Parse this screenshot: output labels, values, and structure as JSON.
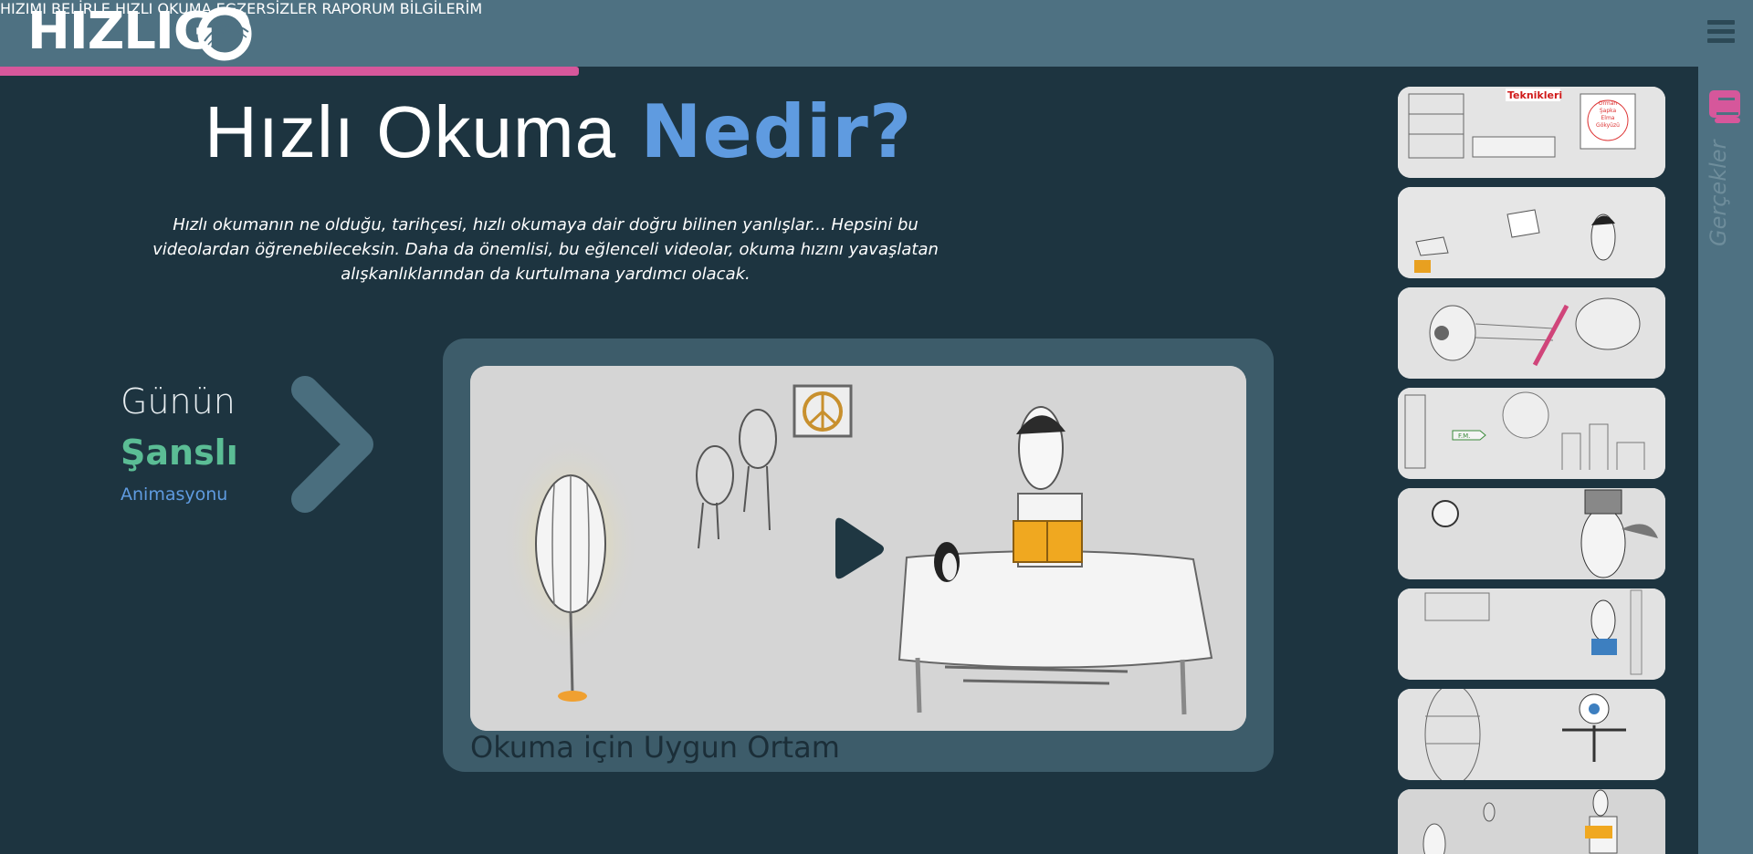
{
  "logo": {
    "text": "HIZLIG"
  },
  "nav": {
    "items": [
      {
        "label": "HIZIMI BELİRLE"
      },
      {
        "label": "HIZLI OKUMA"
      },
      {
        "label": "EGZERSİZLER"
      },
      {
        "label": "RAPORUM"
      },
      {
        "label": "BİLGİLERİM"
      }
    ]
  },
  "progress": {
    "value": 0.33,
    "color": "#d6579b"
  },
  "hero": {
    "title_regular": "Hızlı Okuma",
    "title_bold": "Nedir?",
    "description": "Hızlı okumanın ne olduğu, tarihçesi, hızlı okumaya dair doğru bilinen yanlışlar... Hepsini bu videolardan öğrenebileceksin. Daha da önemlisi, bu eğlenceli videolar, okuma hızını yavaşlatan alışkanlıklarından da kurtulmana yardımcı olacak."
  },
  "featured": {
    "line1": "Günün",
    "line2": "Şanslı",
    "line3": "Animasyonu"
  },
  "video": {
    "caption": "Okuma için Uygun Ortam"
  },
  "sidebar": {
    "rail_label": "Gerçekler",
    "thumb1_sign": "Teknikleri",
    "thumb1_board": [
      "Orman",
      "Şapka",
      "Elma",
      "Gökyüzü"
    ],
    "thumb4_sign": "F.M."
  },
  "colors": {
    "header": "#4e7182",
    "background": "#1d3440",
    "accent_blue": "#5f9be0",
    "accent_green": "#5bbd95",
    "accent_pink": "#d6579b"
  }
}
